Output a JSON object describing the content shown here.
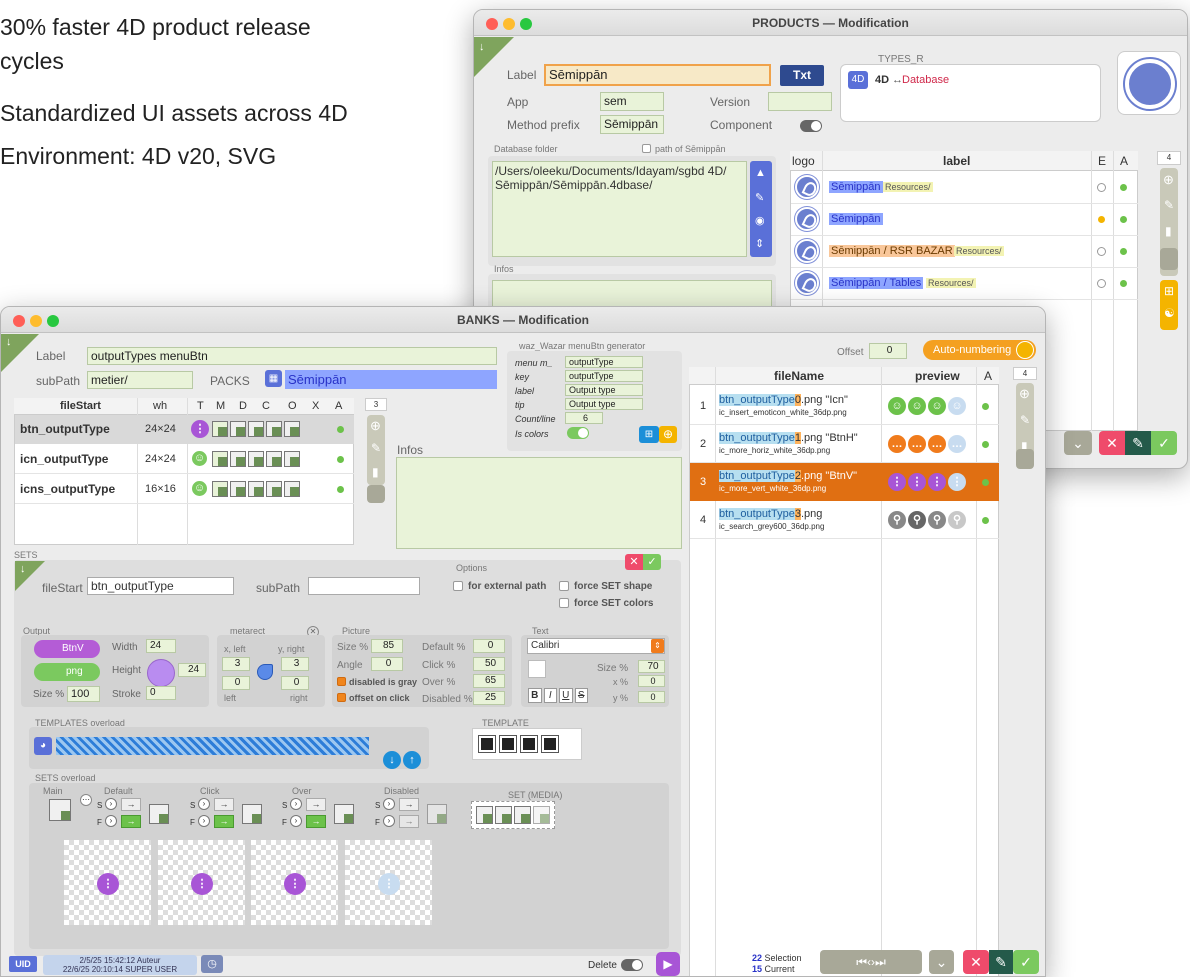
{
  "bullets": [
    "30% faster 4D product release",
    "cycles",
    "Standardized UI assets across 4D",
    "Environment: 4D v20, SVG"
  ],
  "products": {
    "title": "PRODUCTS — Modification",
    "label_caption": "Label",
    "label_value": "Sēmippān",
    "txt_button": "Txt",
    "types_caption": "TYPES_R",
    "types_badge": "4D",
    "types_4d": "4D",
    "types_arrow": "↔",
    "types_db": "Database",
    "app_caption": "App",
    "app_value": "sem",
    "version_caption": "Version",
    "method_caption": "Method prefix",
    "method_value": "Sēmippān",
    "component_caption": "Component",
    "dbfolder_caption": "Database folder",
    "path_check_label": "path of Sēmippān",
    "dbfolder_value": "/Users/oleeku/Documents/Idayam/sgbd 4D/\nSēmippān/Sēmippān.4dbase/",
    "infos_caption": "Infos",
    "list_headers": {
      "logo": "logo",
      "label": "label",
      "e": "E",
      "a": "A"
    },
    "list_count": "4",
    "list_rows": [
      {
        "label": "Sēmippān",
        "tag": "Resources/"
      },
      {
        "label": "Sēmippān",
        "tag": ""
      },
      {
        "label": "Sēmippān / RSR BAZAR",
        "tag": "Resources/"
      },
      {
        "label": "Sēmippān / Tables",
        "tag": "Resources/"
      }
    ]
  },
  "banks": {
    "title": "BANKS — Modification",
    "label_caption": "Label",
    "label_value": "outputTypes menuBtn",
    "subpath_caption": "subPath",
    "subpath_value": "metier/",
    "packs_caption": "PACKS",
    "packs_value": "Sēmippān",
    "gen": {
      "title": "waz_Wazar menuBtn generator",
      "rows": [
        {
          "k": "menu m_",
          "v": "outputType"
        },
        {
          "k": "key",
          "v": "outputType"
        },
        {
          "k": "label",
          "v": "Output type"
        },
        {
          "k": "tip",
          "v": "Output type"
        }
      ],
      "count_caption": "Count/line",
      "count_value": "6",
      "iscolors_caption": "Is colors"
    },
    "offset_caption": "Offset",
    "offset_value": "0",
    "autonum": "Auto-numbering",
    "table_headers": [
      "fileStart",
      "wh",
      "T",
      "M",
      "D",
      "C",
      "O",
      "X",
      "A"
    ],
    "table_count": "3",
    "table_rows": [
      {
        "name": "btn_outputType",
        "wh": "24×24"
      },
      {
        "name": "icn_outputType",
        "wh": "24×24"
      },
      {
        "name": "icns_outputType",
        "wh": "16×16"
      }
    ],
    "infos_caption": "Infos",
    "files_headers": {
      "file": "fileName",
      "preview": "preview",
      "a": "A"
    },
    "files_count": "4",
    "files": [
      {
        "n": "1",
        "pre": "btn_outputType",
        "num": "0",
        "post": ".png \"Icn\"",
        "sub": "ic_insert_emoticon_white_36dp.png"
      },
      {
        "n": "2",
        "pre": "btn_outputType",
        "num": "1",
        "post": ".png \"BtnH\"",
        "sub": "ic_more_horiz_white_36dp.png"
      },
      {
        "n": "3",
        "pre": "btn_outputType",
        "num": "2",
        "post": ".png \"BtnV\"",
        "sub": "ic_more_vert_white_36dp.png"
      },
      {
        "n": "4",
        "pre": "btn_outputType",
        "num": "3",
        "post": ".png",
        "sub": "ic_search_grey600_36dp.png"
      }
    ],
    "sets": {
      "caption": "SETS",
      "options_caption": "Options",
      "filestart_caption": "fileStart",
      "filestart_value": "btn_outputType",
      "subpath_caption": "subPath",
      "opt_external": "for external path",
      "opt_shape": "force SET shape",
      "opt_colors": "force SET colors",
      "output_caption": "Output",
      "btnv": "BtnV",
      "png": "png",
      "width_caption": "Width",
      "width_value": "24",
      "height_caption": "Height",
      "height_value": "24",
      "size_caption": "Size %",
      "size_value": "100",
      "stroke_caption": "Stroke",
      "stroke_value": "0",
      "metarect_caption": "metarect",
      "xleft": "x, left",
      "yright": "y, right",
      "left": "left",
      "right": "right",
      "m1": "3",
      "m2": "3",
      "m3": "0",
      "m4": "0",
      "picture_caption": "Picture",
      "psize_caption": "Size %",
      "psize_value": "85",
      "angle_caption": "Angle",
      "angle_value": "0",
      "disabled_gray": "disabled is gray",
      "offset_click": "offset on click",
      "default_caption": "Default %",
      "default_value": "0",
      "click_caption": "Click %",
      "click_value": "50",
      "over_caption": "Over %",
      "over_value": "65",
      "disabledp_caption": "Disabled %",
      "disabledp_value": "25",
      "text_caption": "Text",
      "font_value": "Calibri",
      "tsize_caption": "Size %",
      "tsize_value": "70",
      "x_caption": "x %",
      "x_value": "0",
      "y_caption": "y %",
      "y_value": "0",
      "templates_caption": "TEMPLATES overload",
      "template_caption": "TEMPLATE",
      "setsover_caption": "SETS overload",
      "main": "Main",
      "default": "Default",
      "click": "Click",
      "over": "Over",
      "disabled": "Disabled",
      "setmedia": "SET (MEDIA)",
      "s": "S",
      "f": "F"
    },
    "footer": {
      "uid": "UID",
      "line1": "2/5/25 15:42:12 Auteur",
      "line2": "22/6/25 20:10:14 SUPER USER",
      "delete": "Delete",
      "sel_num": "22",
      "sel_label": "Selection",
      "cur_num": "15",
      "cur_label": "Current"
    }
  }
}
